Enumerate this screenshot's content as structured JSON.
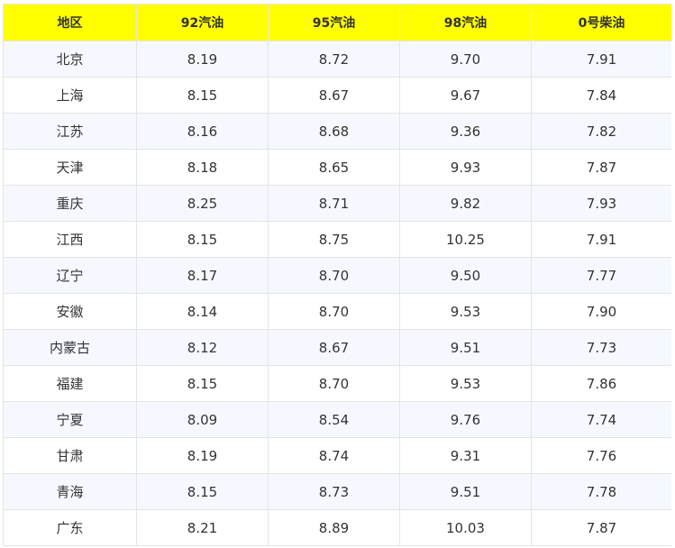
{
  "table": {
    "headers": [
      "地区",
      "92汽油",
      "95汽油",
      "98汽油",
      "0号柴油"
    ],
    "rows": [
      [
        "北京",
        "8.19",
        "8.72",
        "9.70",
        "7.91"
      ],
      [
        "上海",
        "8.15",
        "8.67",
        "9.67",
        "7.84"
      ],
      [
        "江苏",
        "8.16",
        "8.68",
        "9.36",
        "7.82"
      ],
      [
        "天津",
        "8.18",
        "8.65",
        "9.93",
        "7.87"
      ],
      [
        "重庆",
        "8.25",
        "8.71",
        "9.82",
        "7.93"
      ],
      [
        "江西",
        "8.15",
        "8.75",
        "10.25",
        "7.91"
      ],
      [
        "辽宁",
        "8.17",
        "8.70",
        "9.50",
        "7.77"
      ],
      [
        "安徽",
        "8.14",
        "8.70",
        "9.53",
        "7.90"
      ],
      [
        "内蒙古",
        "8.12",
        "8.67",
        "9.51",
        "7.73"
      ],
      [
        "福建",
        "8.15",
        "8.70",
        "9.53",
        "7.86"
      ],
      [
        "宁夏",
        "8.09",
        "8.54",
        "9.76",
        "7.74"
      ],
      [
        "甘肃",
        "8.19",
        "8.74",
        "9.31",
        "7.76"
      ],
      [
        "青海",
        "8.15",
        "8.73",
        "9.51",
        "7.78"
      ],
      [
        "广东",
        "8.21",
        "8.89",
        "10.03",
        "7.87"
      ]
    ]
  },
  "colors": {
    "header_bg": "#ffff00",
    "row_alt_bg": "#f5f9ff",
    "border": "#e4e4e4",
    "text": "#333333"
  }
}
